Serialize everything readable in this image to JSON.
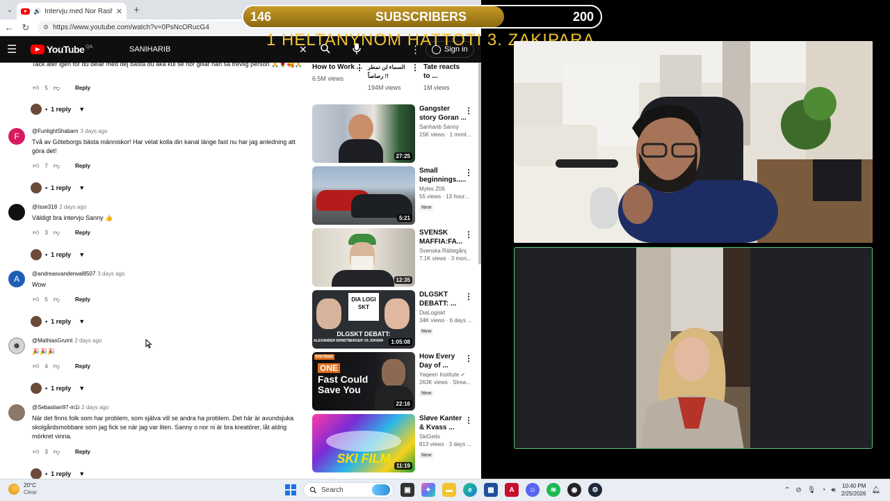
{
  "browser": {
    "tab_title": "Intervju med Nor Rasheed kä",
    "url": "https://www.youtube.com/watch?v=0PsNcORucG4"
  },
  "youtube": {
    "logo": "YouTube",
    "country": "QA",
    "search_query": "SANIHARIB",
    "sign_in": "Sign in"
  },
  "comments": [
    {
      "author": "",
      "ago": "",
      "text": "Tack åter igen för du delar med dej bästa du åka kul se nor gillar han så trevlig person 🙏🌹🥰🙏",
      "likes": "5",
      "reply_label": "Reply",
      "replies": "1 reply",
      "avatar_letter": "",
      "avatar_color": "#999"
    },
    {
      "author": "@FunlightShabam",
      "ago": "3 days ago",
      "text": "Två av Göteborgs bästa människor! Har velat kolla din kanal länge fast nu har jag anledning att göra det!",
      "likes": "7",
      "reply_label": "Reply",
      "replies": "1 reply",
      "avatar_letter": "F",
      "avatar_color": "#d81b60"
    },
    {
      "author": "@Isse318",
      "ago": "2 days ago",
      "text": "Väldigt bra intervju Sanny 👍",
      "likes": "3",
      "reply_label": "Reply",
      "replies": "1 reply",
      "avatar_letter": "",
      "avatar_color": "#111111"
    },
    {
      "author": "@andreasvanderwal8507",
      "ago": "3 days ago",
      "text": "Wow",
      "likes": "5",
      "reply_label": "Reply",
      "replies": "1 reply",
      "avatar_letter": "A",
      "avatar_color": "#1e5fb5"
    },
    {
      "author": "@MathiasGrumt",
      "ago": "2 days ago",
      "text": "🎉🎉🎉",
      "likes": "4",
      "reply_label": "Reply",
      "replies": "1 reply",
      "avatar_letter": "",
      "avatar_color": "#b0aabb"
    },
    {
      "author": "@Sebastian97-m1i",
      "ago": "2 days ago",
      "text": "När det finns folk som har problem, som själva vill se andra ha problem. Det här är avundsjuka skolgårdsmobbare som jag fick se när jag var liten. Sanny o nor ni är bra kreatörer, låt aldrig mörkret vinna.",
      "likes": "3",
      "reply_label": "Reply",
      "replies": "1 reply",
      "avatar_letter": "",
      "avatar_color": "#8d7766"
    }
  ],
  "related_top": [
    {
      "title": "How to Work ...",
      "views": "6.5M views"
    },
    {
      "title": "السماء لن تمطر رصاصاً !!",
      "views": "194M views"
    },
    {
      "title": "Tate reacts to ...",
      "views": "1M views"
    }
  ],
  "related": [
    {
      "title": "Gangster story Goran ...",
      "channel": "Sanharib Sanny",
      "meta": "15K views · 1 mont...",
      "duration": "27:25",
      "is_new": "",
      "thumb_icon": "man-in-suit-thumbnail"
    },
    {
      "title": "Small beginnings.....",
      "channel": "Myles Z06",
      "meta": "55 views · 13 hour...",
      "duration": "5:21",
      "is_new": "New",
      "thumb_icon": "sports-cars-thumbnail"
    },
    {
      "title": "SVENSK MAFFIA:FA...",
      "channel": "Svenska Rättegång...",
      "meta": "7.1K views · 3 mon...",
      "duration": "12:35",
      "is_new": "",
      "thumb_icon": "old-man-thumbnail"
    },
    {
      "title": "DLGSKT DEBATT: ...",
      "channel": "DiaLogiskt",
      "meta": "34K views · 6 days ...",
      "duration": "1:05:08",
      "is_new": "New",
      "thumb_icon": "debate-thumbnail",
      "thumb_text_a": "DIA LOGI SKT",
      "thumb_text_b": "DLGSKT DEBATT:",
      "thumb_text_c": "ALEXANDER ERNSTBERGER VS JOHANN"
    },
    {
      "title": "How Every Day of ...",
      "channel": "Yaqeen Institute",
      "meta": "263K views · Strea...",
      "duration": "22:16",
      "is_new": "New",
      "thumb_icon": "sermon-thumbnail",
      "thumb_text_a": "ONE",
      "thumb_text_b": "Fast Could",
      "thumb_text_c": "Save You",
      "thumb_tag": "KHUTBAH"
    },
    {
      "title": "Sløve Kanter & Kvass ...",
      "channel": "SkiGeilo",
      "meta": "813 views · 3 days ...",
      "duration": "11:19",
      "is_new": "New",
      "thumb_icon": "ski-film-thumbnail",
      "thumb_text_a": "SKI FILM"
    }
  ],
  "overlay": {
    "current": "146",
    "label": "SUBSCRIBERS",
    "goal": "200",
    "progress": 0.73,
    "ticker": "1 HELTANYNOM  HATTOTI  3.  ZAKIPARA"
  },
  "taskbar": {
    "temp": "20°C",
    "condition": "Clear",
    "search": "Search",
    "time": "10:40 PM",
    "date": "2/25/2026"
  }
}
